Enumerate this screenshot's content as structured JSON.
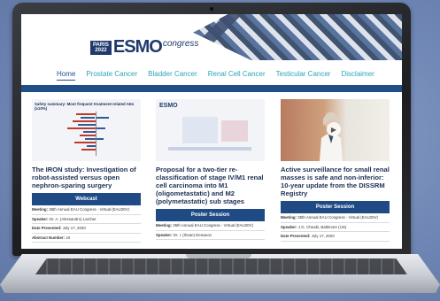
{
  "header": {
    "logo": {
      "city": "PARIS",
      "year": "2022",
      "brand": "ESMO",
      "suffix": "congress"
    }
  },
  "nav": {
    "items": [
      {
        "label": "Home",
        "active": true
      },
      {
        "label": "Prostate Cancer",
        "active": false
      },
      {
        "label": "Bladder Cancer",
        "active": false
      },
      {
        "label": "Renal Cell Cancer",
        "active": false
      },
      {
        "label": "Testicular Cancer",
        "active": false
      },
      {
        "label": "Disclaimer",
        "active": false
      }
    ]
  },
  "cards": [
    {
      "thumb_title": "Safety summary: Most frequent treatment-related AEs (≥10%)",
      "title": "The IRON study: Investigation of robot-assisted versus open nephron-sparing surgery",
      "badge": "Webcast",
      "meta": [
        {
          "k": "Meeting:",
          "v": "35th Annual EAU Congress - Virtual (EAU20V)"
        },
        {
          "k": "Speaker:",
          "v": "Dr. A. (Alessandro) Larcher"
        },
        {
          "k": "Date Presented:",
          "v": "July 17, 2020"
        },
        {
          "k": "Abstract Number:",
          "v": "10"
        }
      ]
    },
    {
      "thumb_logo": "ESMO",
      "title": "Proposal for a two-tier re-classification of stage IV/M1 renal cell carcinoma into M1 (oligometastatic) and M2 (polymetastatic) sub stages",
      "badge": "Poster Session",
      "meta": [
        {
          "k": "Meeting:",
          "v": "35th Annual EAU Congress - Virtual (EAU20V)"
        },
        {
          "k": "Speaker:",
          "v": "Dr. I. (Ihsan) Denaeon"
        }
      ]
    },
    {
      "title": "Active surveillance for small renal masses is safe and non-inferior: 10-year update from the DISSRM Registry",
      "badge": "Poster Session",
      "meta": [
        {
          "k": "Meeting:",
          "v": "35th Annual EAU Congress - Virtual (EAU20V)"
        },
        {
          "k": "Speaker:",
          "v": "J.G. Cheaib, Baltimore (US)"
        },
        {
          "k": "Date Presented:",
          "v": "July 17, 2020"
        }
      ]
    }
  ],
  "colors": {
    "navy": "#1f4f86",
    "teal": "#2aa5b6",
    "badge": "#1f4a84"
  },
  "icons": {
    "play": "play-icon"
  }
}
